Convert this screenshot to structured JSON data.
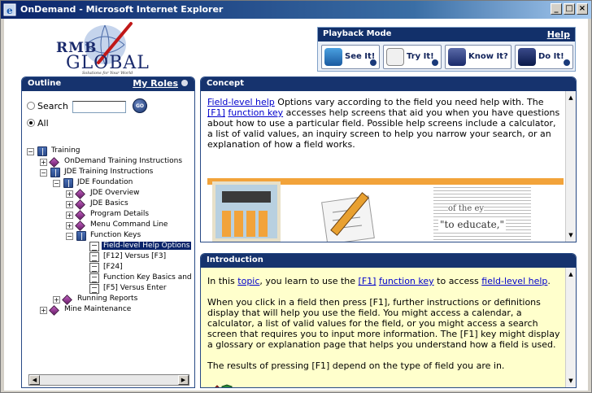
{
  "window": {
    "title": "OnDemand - Microsoft Internet Explorer",
    "minimize": "_",
    "maximize": "□",
    "close": "×"
  },
  "logo": {
    "line1": "RMB",
    "line2": "GLOBAL",
    "tagline": "Solutions for Your World"
  },
  "playback": {
    "title": "Playback Mode",
    "help": "Help",
    "buttons": [
      {
        "label": "See It!",
        "icon": "see-it-icon"
      },
      {
        "label": "Try It!",
        "icon": "try-it-icon"
      },
      {
        "label": "Know It?",
        "icon": "know-it-icon"
      },
      {
        "label": "Do It!",
        "icon": "do-it-icon"
      }
    ]
  },
  "outline": {
    "title": "Outline",
    "roles": "My Roles",
    "search_label": "Search",
    "search_value": "",
    "go_label": "GO",
    "all_label": "All",
    "tree": [
      {
        "label": "Training",
        "icon": "book",
        "expander": "−",
        "selected": false
      },
      {
        "label": "OnDemand Training Instructions",
        "icon": "diamond",
        "expander": "+",
        "selected": false
      },
      {
        "label": "JDE Training Instructions",
        "icon": "book",
        "expander": "−",
        "selected": false
      },
      {
        "label": "JDE Foundation",
        "icon": "book",
        "expander": "−",
        "selected": false
      },
      {
        "label": "JDE Overview",
        "icon": "diamond",
        "expander": "+",
        "selected": false
      },
      {
        "label": "JDE Basics",
        "icon": "diamond",
        "expander": "+",
        "selected": false
      },
      {
        "label": "Program Details",
        "icon": "diamond",
        "expander": "+",
        "selected": false
      },
      {
        "label": "Menu Command Line",
        "icon": "diamond",
        "expander": "+",
        "selected": false
      },
      {
        "label": "Function Keys",
        "icon": "book",
        "expander": "−",
        "selected": false
      },
      {
        "label": "Field-level Help Options",
        "icon": "page",
        "expander": "",
        "selected": true
      },
      {
        "label": "[F12] Versus [F3]",
        "icon": "page",
        "expander": "",
        "selected": false
      },
      {
        "label": "[F24]",
        "icon": "page",
        "expander": "",
        "selected": false
      },
      {
        "label": "Function Key Basics and",
        "icon": "page",
        "expander": "",
        "selected": false
      },
      {
        "label": "[F5] Versus Enter",
        "icon": "page",
        "expander": "",
        "selected": false
      },
      {
        "label": "Running Reports",
        "icon": "diamond",
        "expander": "+",
        "selected": false
      },
      {
        "label": "Mine Maintenance",
        "icon": "diamond",
        "expander": "+",
        "selected": false
      }
    ]
  },
  "concept": {
    "title": "Concept",
    "link1": "Field-level help",
    "text1": " Options vary according to the field you need help with. The ",
    "link2": "[F1]",
    "text2": " ",
    "link3": "function key",
    "text3": " accesses help screens that aid you when you have questions about how to use a particular field. Possible help screens include a calculator, a list of valid values, an inquiry screen to help you narrow your search, or an explanation of how a field works.",
    "image_text_main": "\"to educate,\"",
    "image_text_small": "of the ey"
  },
  "introduction": {
    "title": "Introduction",
    "p1_a": "In this ",
    "p1_link1": "topic",
    "p1_b": ", you learn to use the ",
    "p1_link2": "[F1]",
    "p1_c": " ",
    "p1_link3": "function key",
    "p1_d": " to access ",
    "p1_link4": "field-level help",
    "p1_e": ".",
    "p2": "When you click in a field then press [F1], further instructions or definitions display that will help you use the field. You might access a calendar, a calculator, a list of valid values for the field, or you might access a search screen that requires you to input more information. The [F1] key might display a glossary or explanation page that helps you understand how a field is used.",
    "p3": "The results of pressing [F1] depend on the type of field you are in."
  },
  "colors": {
    "panel_header": "#16336e",
    "intro_bg": "#ffffcc",
    "accent_orange": "#f2a33a"
  }
}
